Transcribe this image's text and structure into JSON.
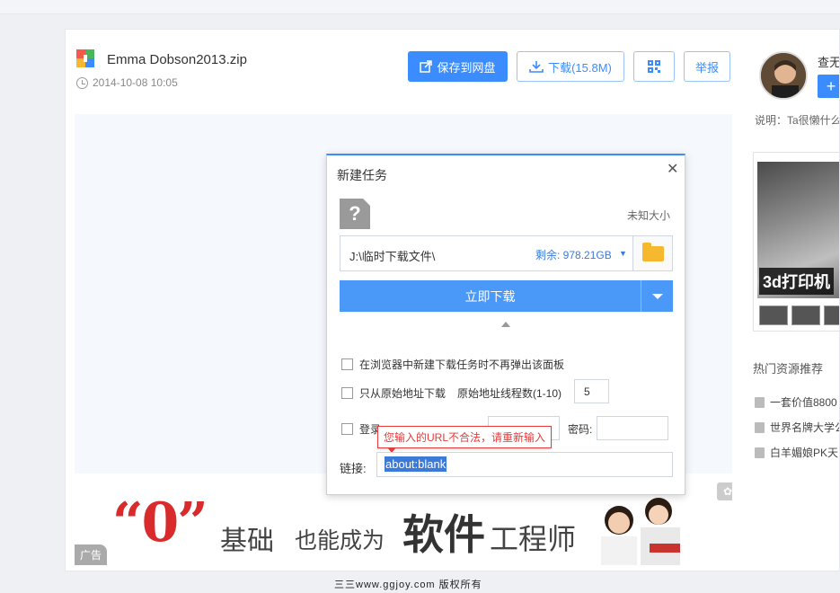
{
  "file": {
    "title": "Emma Dobson2013.zip",
    "date": "2014-10-08 10:05"
  },
  "toolbar": {
    "save_label": "保存到网盘",
    "download_label": "下载(15.8M)",
    "qr_icon": "qr-code-icon",
    "report_label": "举报"
  },
  "ad": {
    "zero_text": "“0”",
    "text1": "基础",
    "text2": "也能成为",
    "text3": "软件",
    "text4": "工程师",
    "tag": "广告"
  },
  "sidebar": {
    "follow_name": "查无",
    "plus_label": "+",
    "description": "说明：Ta很懒什么",
    "ad_label": "3d打印机",
    "hot_title": "热门资源推荐",
    "hot_items": [
      "一套价值8800",
      "世界名牌大学公",
      "白羊媚娘PK天"
    ]
  },
  "dialog": {
    "title": "新建任务",
    "close_label": "✕",
    "file_size": "未知大小",
    "save_path": "J:\\临时下载文件\\",
    "free_space": "剩余: 978.21GB",
    "download_now": "立即下载",
    "option_no_popup": "在浏览器中新建下载任务时不再弹出该面板",
    "option_origin_only": "只从原始地址下载",
    "threads_label": "原始地址线程数(1-10)",
    "threads_value": "5",
    "login_label": "登录",
    "password_label": "密码:",
    "error_tooltip": "您输入的URL不合法，请重新输入",
    "link_label": "链接:",
    "link_value": "about:blank"
  },
  "watermark": "三三www.ggjoy.com 版权所有"
}
